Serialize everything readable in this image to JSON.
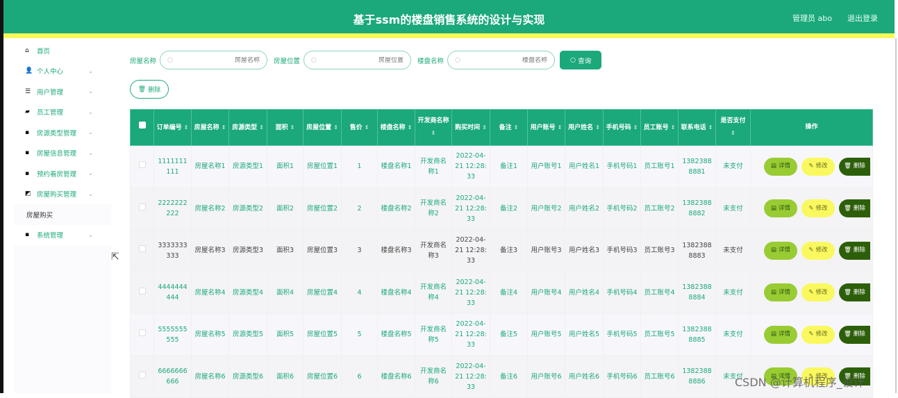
{
  "header": {
    "title": "基于ssm的楼盘销售系统的设计与实现",
    "user": "管理员 abo",
    "logout": "退出登录"
  },
  "sidebar": {
    "items": [
      {
        "label": "首页",
        "icon": "home-icon"
      },
      {
        "label": "个人中心",
        "icon": "user-icon"
      },
      {
        "label": "用户管理",
        "icon": "sliders-icon"
      },
      {
        "label": "员工管理",
        "icon": "briefcase-icon"
      },
      {
        "label": "房源类型管理",
        "icon": "grid-icon"
      },
      {
        "label": "房屋信息管理",
        "icon": "grid-icon"
      },
      {
        "label": "预约看房管理",
        "icon": "grid-icon"
      },
      {
        "label": "房屋购买管理",
        "icon": "chart-icon"
      },
      {
        "label": "房屋购买",
        "icon": ""
      },
      {
        "label": "系统管理",
        "icon": "grid-icon"
      }
    ]
  },
  "search": {
    "fields": [
      {
        "label": "房屋名称",
        "placeholder": "房屋名称"
      },
      {
        "label": "房屋位置",
        "placeholder": "房屋位置"
      },
      {
        "label": "楼盘名称",
        "placeholder": "楼盘名称"
      }
    ],
    "query_label": "查询",
    "delete_label": "删除"
  },
  "table": {
    "columns": [
      "订单编号",
      "房屋名称",
      "房源类型",
      "面积",
      "房屋位置",
      "售价",
      "楼盘名称",
      "开发商名称",
      "购买时间",
      "备注",
      "用户账号",
      "用户姓名",
      "手机号码",
      "员工账号",
      "联系电话",
      "是否支付",
      "操作"
    ],
    "rows": [
      [
        "1111111111",
        "房屋名称1",
        "房源类型1",
        "面积1",
        "房屋位置1",
        "1",
        "楼盘名称1",
        "开发商名称1",
        "2022-04-21 12:28:33",
        "备注1",
        "用户账号1",
        "用户姓名1",
        "手机号码1",
        "员工账号1",
        "13823888881",
        "未支付"
      ],
      [
        "2222222222",
        "房屋名称2",
        "房源类型2",
        "面积2",
        "房屋位置2",
        "2",
        "楼盘名称2",
        "开发商名称2",
        "2022-04-21 12:28:33",
        "备注2",
        "用户账号2",
        "用户姓名2",
        "手机号码2",
        "员工账号2",
        "13823888882",
        "未支付"
      ],
      [
        "3333333333",
        "房屋名称3",
        "房源类型3",
        "面积3",
        "房屋位置3",
        "3",
        "楼盘名称3",
        "开发商名称3",
        "2022-04-21 12:28:33",
        "备注3",
        "用户账号3",
        "用户姓名3",
        "手机号码3",
        "员工账号3",
        "13823888883",
        "未支付"
      ],
      [
        "4444444444",
        "房屋名称4",
        "房源类型4",
        "面积4",
        "房屋位置4",
        "4",
        "楼盘名称4",
        "开发商名称4",
        "2022-04-21 12:28:33",
        "备注4",
        "用户账号4",
        "用户姓名4",
        "手机号码4",
        "员工账号4",
        "13823888884",
        "未支付"
      ],
      [
        "5555555555",
        "房屋名称5",
        "房源类型5",
        "面积5",
        "房屋位置5",
        "5",
        "楼盘名称5",
        "开发商名称5",
        "2022-04-21 12:28:33",
        "备注5",
        "用户账号5",
        "用户姓名5",
        "手机号码5",
        "员工账号5",
        "13823888885",
        "未支付"
      ],
      [
        "6666666666",
        "房屋名称6",
        "房源类型6",
        "面积6",
        "房屋位置6",
        "6",
        "楼盘名称6",
        "开发商名称6",
        "2022-04-21 12:28:33",
        "备注6",
        "用户账号6",
        "用户姓名6",
        "手机号码6",
        "员工账号6",
        "13823888886",
        "未支付"
      ]
    ],
    "actions": {
      "detail": "详情",
      "edit": "修改",
      "delete": "删除"
    }
  },
  "watermark": "CSDN @计算机程序_设计",
  "colors": {
    "primary": "#1ba87b",
    "stripe": "#f7f75a",
    "detail": "#99cc33",
    "edit": "#f9f95f",
    "delete": "#2d5f0a"
  }
}
